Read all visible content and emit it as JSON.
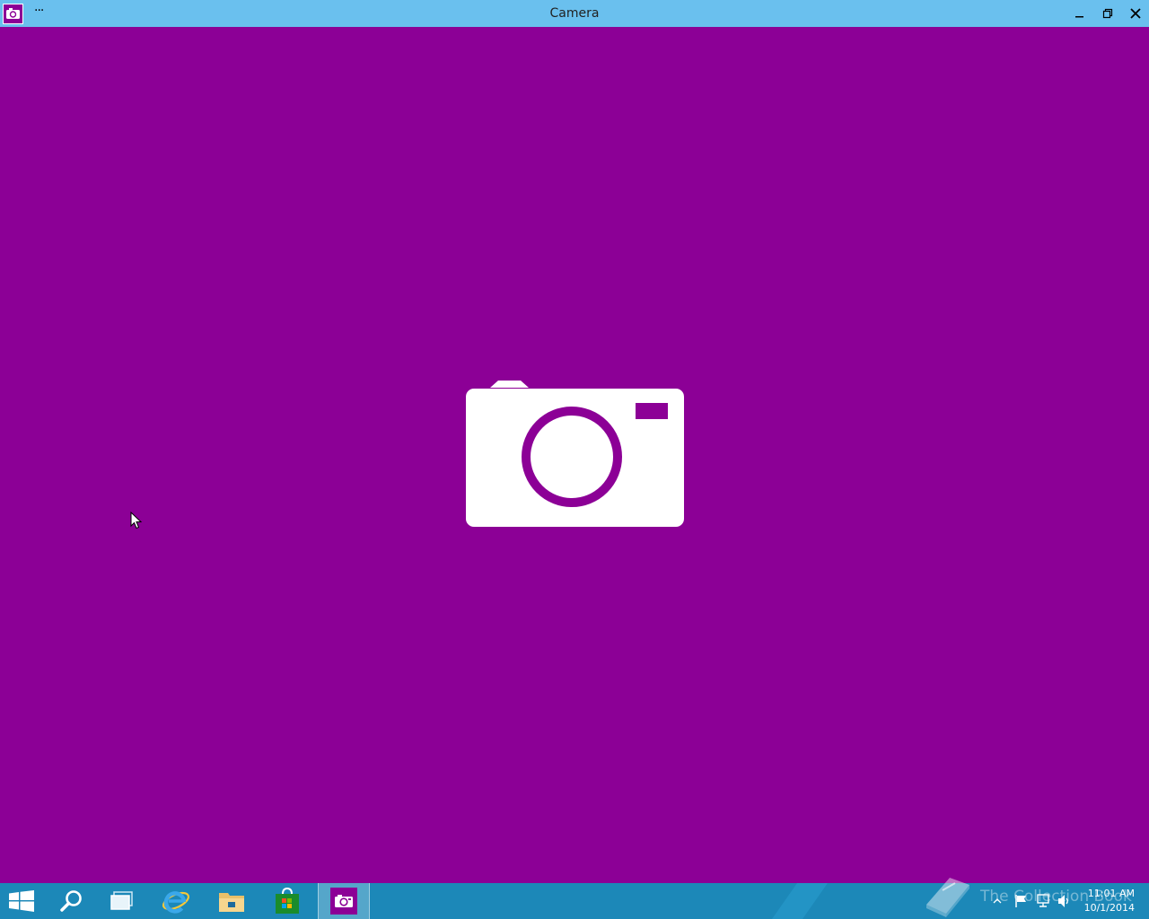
{
  "window": {
    "title": "Camera",
    "menu_glyph": "···",
    "controls": [
      "minimize",
      "restore",
      "close"
    ]
  },
  "colors": {
    "background": "#8c0096",
    "titlebar": "#6ac0ee",
    "taskbar": "#1c88b8",
    "icon_fg": "#ffffff"
  },
  "main": {
    "illustration_icon": "camera-icon"
  },
  "taskbar": {
    "items": [
      {
        "name": "start",
        "icon": "windows-logo-icon"
      },
      {
        "name": "search",
        "icon": "magnifier-icon"
      },
      {
        "name": "task-view",
        "icon": "task-view-icon"
      },
      {
        "name": "internet-explorer",
        "icon": "ie-icon"
      },
      {
        "name": "file-explorer",
        "icon": "folder-icon"
      },
      {
        "name": "store",
        "icon": "store-bag-icon"
      },
      {
        "name": "camera",
        "icon": "camera-icon",
        "active": true
      }
    ],
    "tray_icons": [
      "show-hidden-icon",
      "flag-icon",
      "network-icon",
      "volume-icon"
    ],
    "clock": {
      "time": "11:01 AM",
      "date": "10/1/2014"
    }
  },
  "watermark": {
    "text": "The Collection Book"
  }
}
